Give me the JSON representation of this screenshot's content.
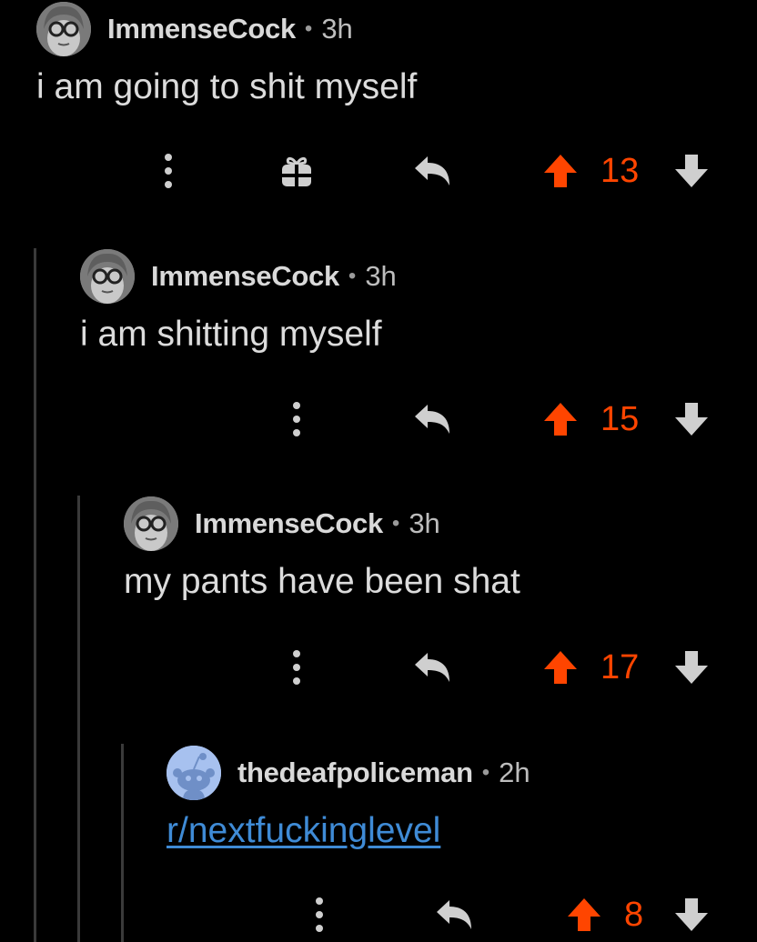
{
  "colors": {
    "upvote": "#ff4500",
    "link": "#3f8bd6",
    "thread_line": "#3a3a3a"
  },
  "comments": [
    {
      "username": "ImmenseCock",
      "time": "3h",
      "text": "i am going to shit myself",
      "score": "13",
      "has_award": true,
      "avatar": "portrait-avatar"
    },
    {
      "username": "ImmenseCock",
      "time": "3h",
      "text": "i am shitting myself",
      "score": "15",
      "has_award": false,
      "avatar": "portrait-avatar"
    },
    {
      "username": "ImmenseCock",
      "time": "3h",
      "text": "my pants have been shat",
      "score": "17",
      "has_award": false,
      "avatar": "portrait-avatar"
    },
    {
      "username": "thedeafpoliceman",
      "time": "2h",
      "text": "r/nextfuckinglevel",
      "score": "8",
      "has_award": false,
      "avatar": "snoo-avatar",
      "text_is_link": true
    }
  ],
  "separator": "•"
}
